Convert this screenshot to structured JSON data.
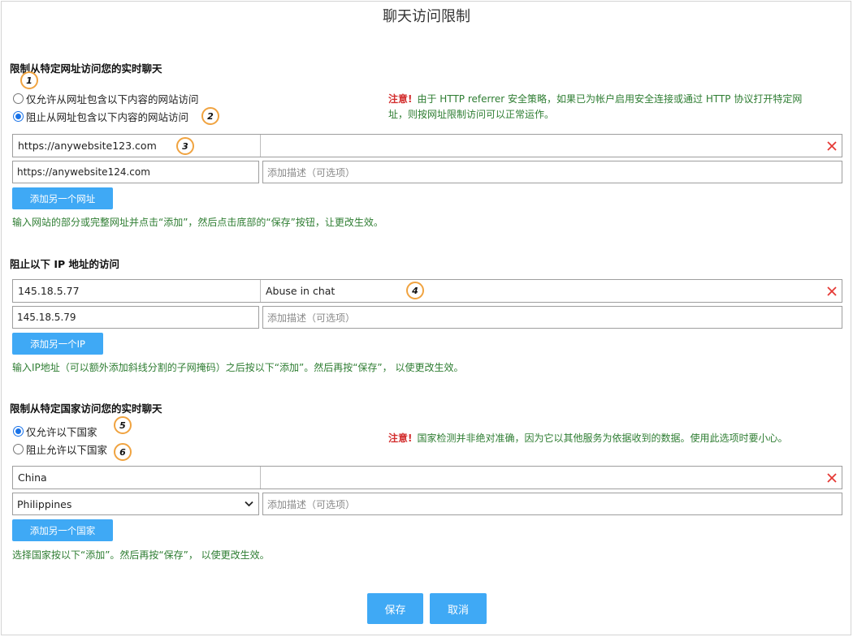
{
  "page": {
    "title": "聊天访问限制"
  },
  "url_section": {
    "title": "限制从特定网址访问您的实时聊天",
    "options": [
      "仅允许从网址包含以下内容的网站访问",
      "阻止从网址包含以下内容的网站访问"
    ],
    "selected_index": 1,
    "note_warn": "注意!",
    "note_text_1": "由于 HTTP referrer 安全策略，如果已为帐户启用安全连接或通过 HTTP 协议打开特定网",
    "note_text_2": "址，则按网址限制访问可以正常运作。",
    "rows": [
      {
        "value": "https://anywebsite123.com",
        "description": ""
      }
    ],
    "new_value": "https://anywebsite124.com",
    "description_placeholder": "添加描述（可选项）",
    "add_button": "添加另一个网址",
    "hint": "输入网站的部分或完整网址并点击“添加”，然后点击底部的“保存”按钮，让更改生效。"
  },
  "ip_section": {
    "title": "阻止以下 IP 地址的访问",
    "rows": [
      {
        "value": "145.18.5.77",
        "description": "Abuse in chat"
      }
    ],
    "new_value": "145.18.5.79",
    "description_placeholder": "添加描述（可选项）",
    "add_button": "添加另一个IP",
    "hint": "输入IP地址（可以额外添加斜线分割的子网掩码）之后按以下“添加”。然后再按“保存”， 以使更改生效。"
  },
  "country_section": {
    "title": "限制从特定国家访问您的实时聊天",
    "options": [
      "仅允许以下国家",
      "阻止允许以下国家"
    ],
    "selected_index": 0,
    "note_warn": "注意!",
    "note_text": "国家检测并非绝对准确，因为它以其他服务为依据收到的数据。使用此选项时要小心。",
    "rows": [
      {
        "value": "China",
        "description": ""
      }
    ],
    "selected_country": "Philippines",
    "description_placeholder": "添加描述（可选项）",
    "add_button": "添加另一个国家",
    "hint": "选择国家按以下“添加”。然后再按“保存”， 以使更改生效。"
  },
  "footer": {
    "save": "保存",
    "cancel": "取消"
  },
  "badges": [
    "1",
    "2",
    "3",
    "4",
    "5",
    "6"
  ],
  "colors": {
    "accent": "#3fa9f5",
    "warning": "#d32f2f",
    "hint": "#2e7d32",
    "badge_ring": "#f0a340",
    "delete_icon": "#e53935"
  },
  "icons": {
    "delete": "close-x-icon",
    "dropdown": "chevron-down-icon"
  }
}
